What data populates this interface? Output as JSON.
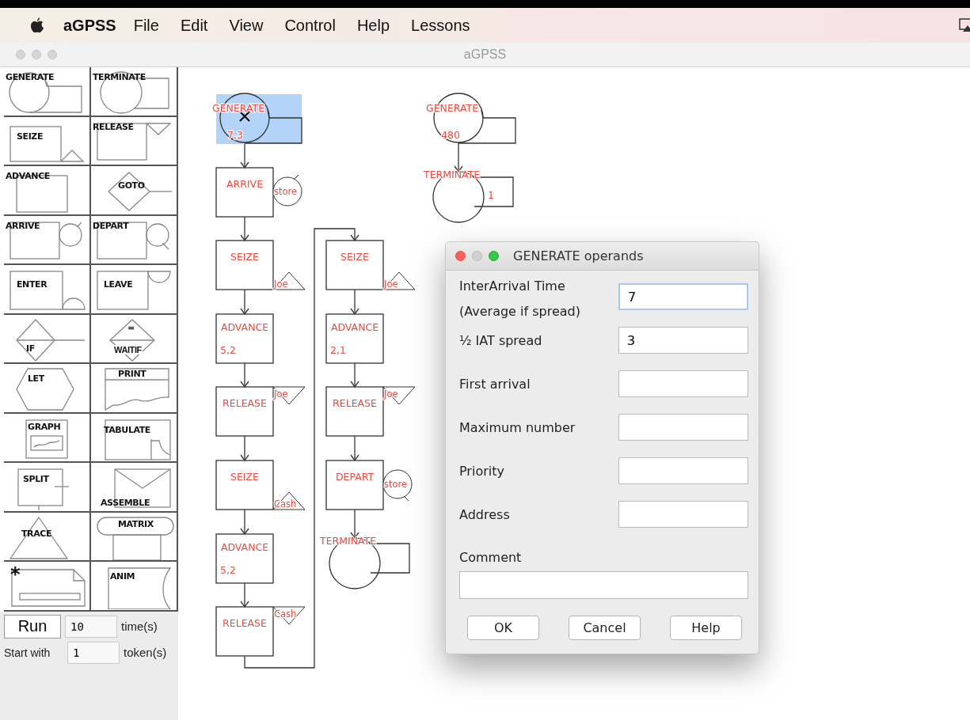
{
  "menu_bar": {
    "app_name": "aGPSS",
    "items": [
      "File",
      "Edit",
      "View",
      "Control",
      "Help",
      "Lessons"
    ]
  },
  "window": {
    "title": "aGPSS"
  },
  "palette": [
    {
      "label": "GENERATE",
      "kind": "generate"
    },
    {
      "label": "TERMINATE",
      "kind": "terminate"
    },
    {
      "label": "SEIZE",
      "kind": "seize"
    },
    {
      "label": "RELEASE",
      "kind": "release"
    },
    {
      "label": "ADVANCE",
      "kind": "advance"
    },
    {
      "label": "GOTO",
      "kind": "goto"
    },
    {
      "label": "ARRIVE",
      "kind": "arrive"
    },
    {
      "label": "DEPART",
      "kind": "depart"
    },
    {
      "label": "ENTER",
      "kind": "enter"
    },
    {
      "label": "LEAVE",
      "kind": "leave"
    },
    {
      "label": "IF",
      "kind": "if"
    },
    {
      "label": "=",
      "kind": "waitif_sign"
    },
    {
      "label": "LET",
      "kind": "let"
    },
    {
      "label": "PRINT",
      "kind": "print"
    },
    {
      "label": "GRAPH",
      "kind": "graph"
    },
    {
      "label": "TABULATE",
      "kind": "tabulate"
    },
    {
      "label": "SPLIT",
      "kind": "split"
    },
    {
      "label": "ASSEMBLE",
      "kind": "assemble"
    },
    {
      "label": "TRACE",
      "kind": "trace"
    },
    {
      "label": "MATRIX",
      "kind": "matrix"
    },
    {
      "label": "*",
      "kind": "comment"
    },
    {
      "label": "ANIM",
      "kind": "anim"
    }
  ],
  "waitif_label": "WAITIF",
  "run_panel": {
    "run_button": "Run",
    "times_value": "10",
    "times_label": "time(s)",
    "start_label": "Start with",
    "tokens_value": "1",
    "tokens_label": "token(s)"
  },
  "diagram": {
    "chains": [
      {
        "continues": true,
        "blocks": [
          {
            "kind": "generate",
            "label": "GENERATE",
            "operand": "7,3",
            "selected": true
          },
          {
            "kind": "arrive",
            "label": "ARRIVE",
            "side_label": "store",
            "selected": false
          },
          {
            "kind": "seize",
            "label": "SEIZE",
            "side_label": "Joe",
            "selected": false
          },
          {
            "kind": "advance",
            "label": "ADVANCE",
            "operand": "5,2",
            "selected": false
          },
          {
            "kind": "release",
            "label": "RELEASE",
            "side_label": "Joe",
            "selected": false
          },
          {
            "kind": "seize",
            "label": "SEIZE",
            "side_label": "Cash",
            "selected": false
          },
          {
            "kind": "advance",
            "label": "ADVANCE",
            "operand": "5,2",
            "selected": false
          },
          {
            "kind": "release",
            "label": "RELEASE",
            "side_label": "Cash",
            "selected": false
          }
        ]
      },
      {
        "blocks": [
          {
            "kind": "seize",
            "label": "SEIZE",
            "side_label": "Joe",
            "selected": false
          },
          {
            "kind": "advance",
            "label": "ADVANCE",
            "operand": "2,1",
            "selected": false
          },
          {
            "kind": "release",
            "label": "RELEASE",
            "side_label": "Joe",
            "selected": false
          },
          {
            "kind": "depart",
            "label": "DEPART",
            "side_label": "store",
            "selected": false
          },
          {
            "kind": "terminate",
            "label": "TERMINATE",
            "selected": false
          }
        ]
      },
      {
        "blocks": [
          {
            "kind": "generate",
            "label": "GENERATE",
            "operand": "480",
            "selected": false
          },
          {
            "kind": "terminate",
            "label": "TERMINATE",
            "operand": "1",
            "selected": false
          }
        ]
      }
    ]
  },
  "dialog": {
    "title": "GENERATE operands",
    "fields": [
      {
        "label": "InterArrival Time\n(Average if spread)",
        "value": "7"
      },
      {
        "label": "½ IAT spread",
        "value": "3"
      },
      {
        "label": "First arrival"
      },
      {
        "label": "Maximum number"
      },
      {
        "label": "Priority"
      },
      {
        "label": "Address"
      }
    ],
    "comment_label": "Comment",
    "buttons": [
      "OK",
      "Cancel",
      "Help"
    ]
  }
}
